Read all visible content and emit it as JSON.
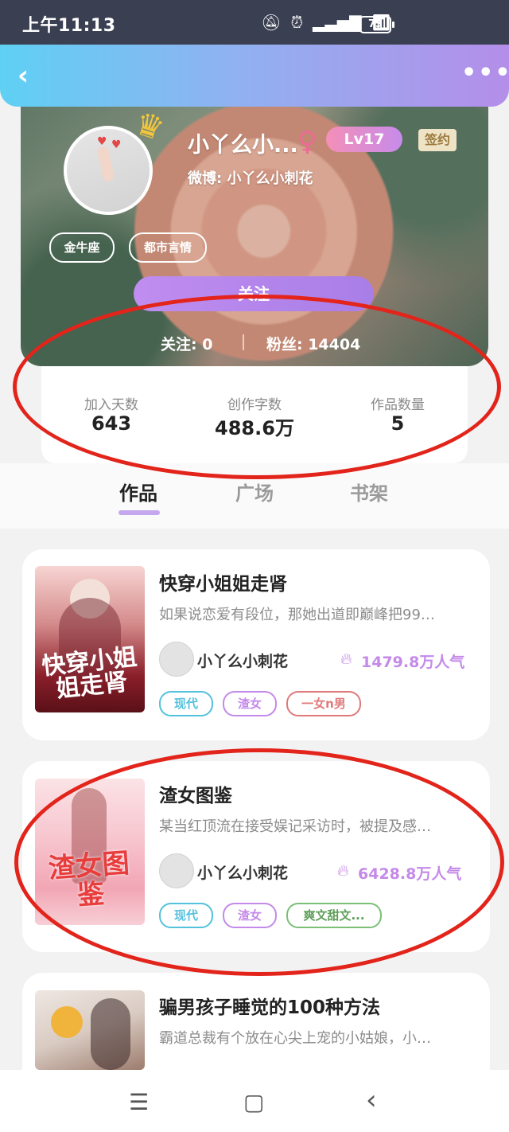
{
  "status_bar": {
    "time": "上午11:13",
    "icons": [
      "bell-off-icon",
      "alarm-icon",
      "signal-icon",
      "wifi-icon"
    ],
    "hd": "HD",
    "battery": "73"
  },
  "header": {
    "back_icon": "‹",
    "more_icon": "•••"
  },
  "profile": {
    "username": "小丫么小...",
    "gender_icon": "♀",
    "level": "Lv17",
    "sign_badge": "签约",
    "weibo": "微博: 小丫么小刺花",
    "tags": [
      "金牛座",
      "都市言情"
    ],
    "follow_button": "关注",
    "following": "关注: 0",
    "fans": "粉丝: 14404"
  },
  "stats": [
    {
      "label": "加入天数",
      "value": "643"
    },
    {
      "label": "创作字数",
      "value": "488.6万"
    },
    {
      "label": "作品数量",
      "value": "5"
    }
  ],
  "tabs": [
    "作品",
    "广场",
    "书架"
  ],
  "books": [
    {
      "title": "快穿小姐姐走肾",
      "desc": "如果说恋爱有段位，那她出道即巅峰把99…",
      "author": "小丫么小刺花",
      "popularity": "1479.8万人气",
      "tags": [
        "现代",
        "渣女",
        "一女n男"
      ],
      "cover_text": "快穿小姐姐走肾",
      "cover_small": "小丫么小刺花"
    },
    {
      "title": "渣女图鉴",
      "desc": "某当红顶流在接受娱记采访时，被提及感…",
      "author": "小丫么小刺花",
      "popularity": "6428.8万人气",
      "tags": [
        "现代",
        "渣女",
        "爽文甜文..."
      ],
      "cover_text": "渣女图鉴",
      "cover_small": "小丫么小刺花"
    },
    {
      "title": "骗男孩子睡觉的100种方法",
      "desc": "霸道总裁有个放在心尖上宠的小姑娘，小…"
    }
  ],
  "colors": {
    "accent_purple": "#c48ae9",
    "tag_blue": "#54c2dd",
    "tag_purple": "#c48ae9",
    "tag_red": "#e07a7a",
    "tag_green": "#7cbf77",
    "annotation_red": "#e2241b"
  },
  "nav": {
    "menu_icon": "☰",
    "home_icon": "▢",
    "back_icon": "‹"
  }
}
